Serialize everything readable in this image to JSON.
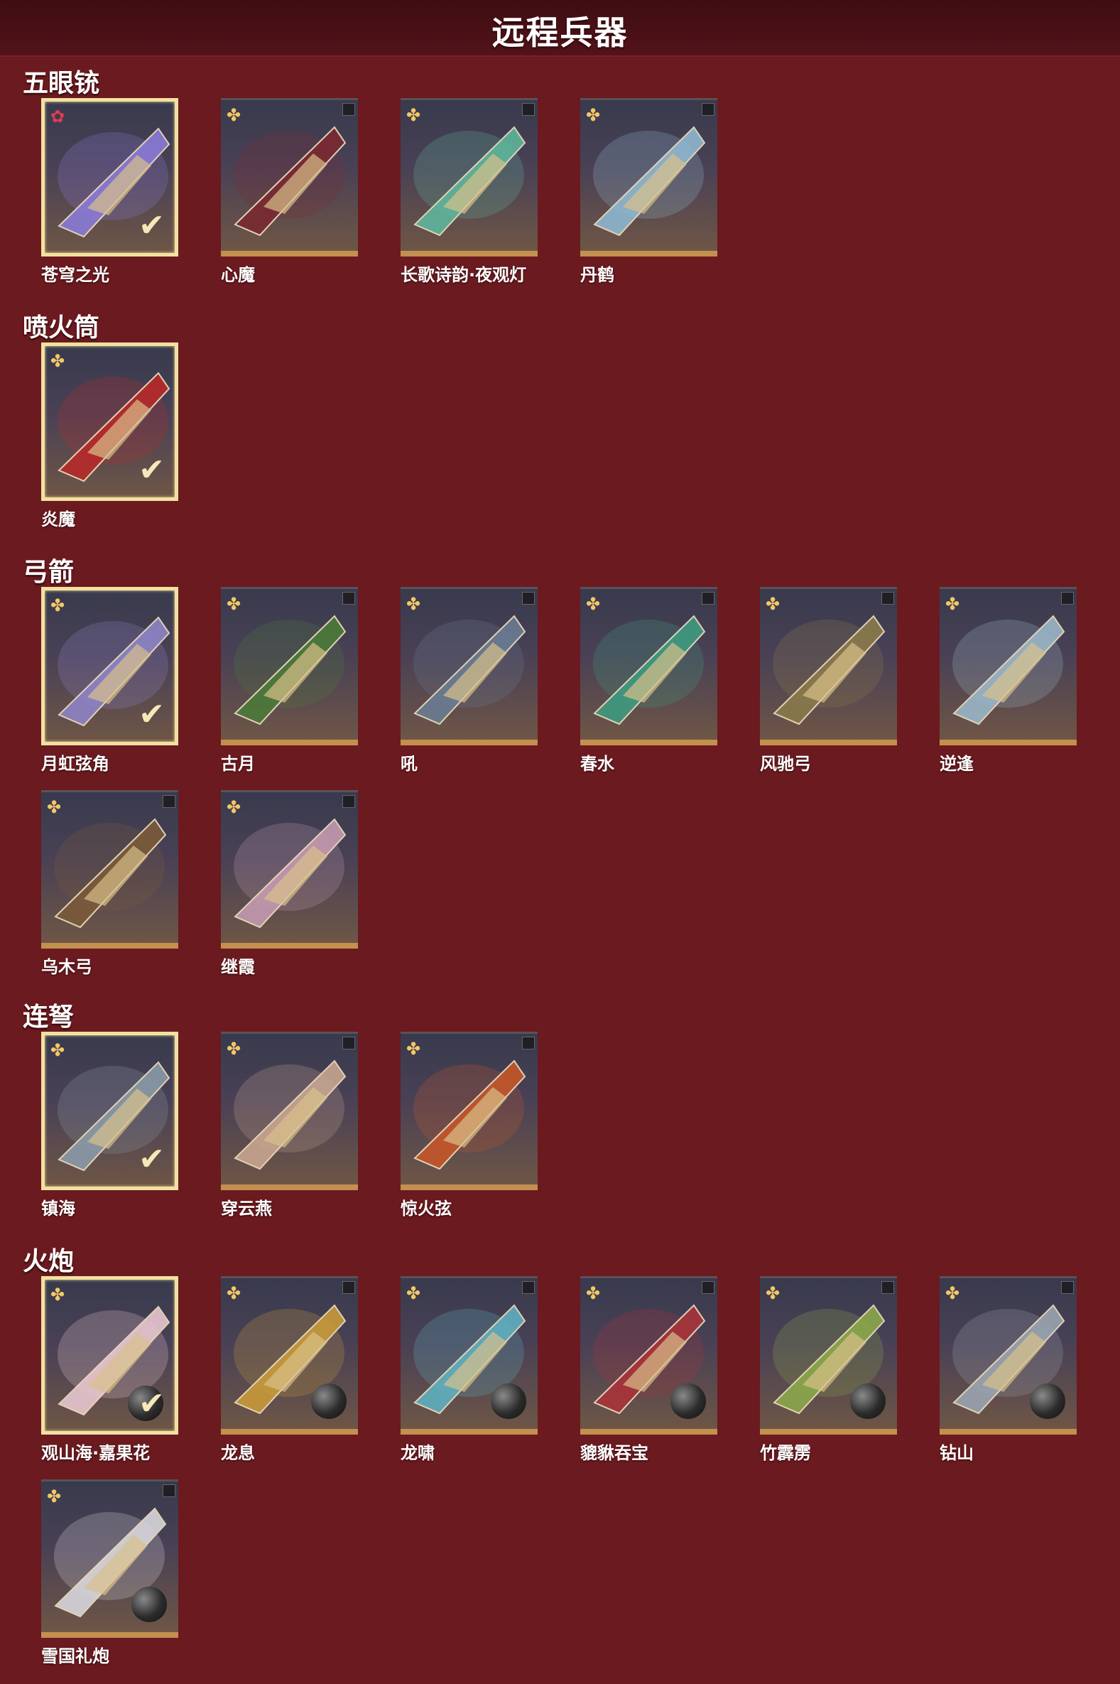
{
  "page": {
    "title": "远程兵器"
  },
  "sections": [
    {
      "title": "五眼铳",
      "items": [
        {
          "name": "苍穹之光",
          "equipped": true,
          "rare": true,
          "color": "#8a7bd6"
        },
        {
          "name": "心魔",
          "equipped": false,
          "rare": false,
          "color": "#7a2a32"
        },
        {
          "name": "长歌诗韵·夜观灯",
          "equipped": false,
          "rare": false,
          "color": "#5fb59b"
        },
        {
          "name": "丹鹤",
          "equipped": false,
          "rare": false,
          "color": "#8fb7d0"
        }
      ]
    },
    {
      "title": "喷火筒",
      "items": [
        {
          "name": "炎魔",
          "equipped": true,
          "rare": false,
          "color": "#b72a2a"
        }
      ]
    },
    {
      "title": "弓箭",
      "items": [
        {
          "name": "月虹弦角",
          "equipped": true,
          "rare": false,
          "color": "#8e84c6"
        },
        {
          "name": "古月",
          "equipped": false,
          "rare": false,
          "color": "#4c7a3a"
        },
        {
          "name": "吼",
          "equipped": false,
          "rare": false,
          "color": "#6a7c92"
        },
        {
          "name": "春水",
          "equipped": false,
          "rare": false,
          "color": "#3f9a80"
        },
        {
          "name": "风驰弓",
          "equipped": false,
          "rare": false,
          "color": "#8a7a4c"
        },
        {
          "name": "逆逢",
          "equipped": false,
          "rare": false,
          "color": "#9ab6c8"
        },
        {
          "name": "乌木弓",
          "equipped": false,
          "rare": false,
          "color": "#7a5a3a"
        },
        {
          "name": "继霞",
          "equipped": false,
          "rare": false,
          "color": "#c49ab0"
        }
      ]
    },
    {
      "title": "连弩",
      "items": [
        {
          "name": "镇海",
          "equipped": true,
          "rare": false,
          "color": "#8a9aa8"
        },
        {
          "name": "穿云燕",
          "equipped": false,
          "rare": false,
          "color": "#c7a590"
        },
        {
          "name": "惊火弦",
          "equipped": false,
          "rare": false,
          "color": "#c4562a"
        }
      ]
    },
    {
      "title": "火炮",
      "items": [
        {
          "name": "观山海·嘉果花",
          "equipped": true,
          "rare": false,
          "cannon": true,
          "color": "#e8c6d0"
        },
        {
          "name": "龙息",
          "equipped": false,
          "rare": false,
          "cannon": true,
          "color": "#c89a3a"
        },
        {
          "name": "龙啸",
          "equipped": false,
          "rare": false,
          "cannon": true,
          "color": "#5fb0c0"
        },
        {
          "name": "貔貅吞宝",
          "equipped": false,
          "rare": false,
          "cannon": true,
          "color": "#a8343a"
        },
        {
          "name": "竹霹雳",
          "equipped": false,
          "rare": false,
          "cannon": true,
          "color": "#8aa84a"
        },
        {
          "name": "钻山",
          "equipped": false,
          "rare": false,
          "cannon": true,
          "color": "#9aa4b0"
        },
        {
          "name": "雪国礼炮",
          "equipped": false,
          "rare": false,
          "cannon": true,
          "color": "#d8d6dc"
        }
      ]
    }
  ],
  "icons": {
    "badge": "flower-badge-icon",
    "equipped": "checkmark-icon",
    "corner": "corner-tag-icon",
    "ammo": "cannonball-icon"
  }
}
